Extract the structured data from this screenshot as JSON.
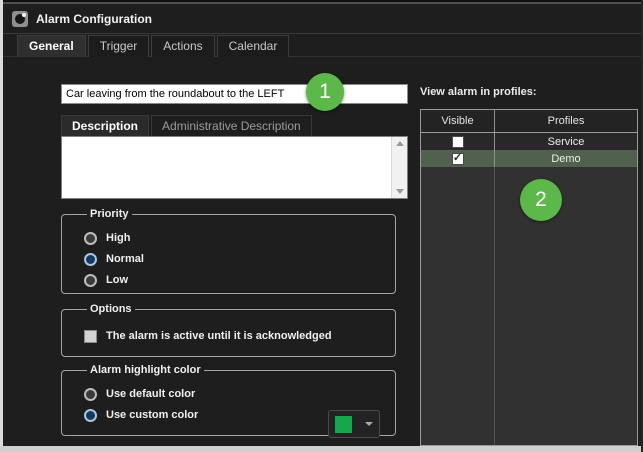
{
  "window": {
    "title": "Alarm Configuration"
  },
  "tabs": [
    {
      "label": "General",
      "selected": true
    },
    {
      "label": "Trigger",
      "selected": false
    },
    {
      "label": "Actions",
      "selected": false
    },
    {
      "label": "Calendar",
      "selected": false
    }
  ],
  "general": {
    "name_value": "Car leaving from the roundabout to the LEFT",
    "description_tabs": [
      {
        "label": "Description",
        "selected": true
      },
      {
        "label": "Administrative Description",
        "selected": false
      }
    ],
    "description_value": "",
    "priority": {
      "legend": "Priority",
      "options": [
        {
          "label": "High",
          "selected": false
        },
        {
          "label": "Normal",
          "selected": true
        },
        {
          "label": "Low",
          "selected": false
        }
      ]
    },
    "options": {
      "legend": "Options",
      "checkbox_label": "The alarm is active until it is acknowledged",
      "checked": false
    },
    "highlight": {
      "legend": "Alarm highlight color",
      "default_label": "Use default color",
      "custom_label": "Use custom color",
      "custom_selected": true
    }
  },
  "profiles_panel": {
    "label": "View alarm in profiles:",
    "columns": [
      "Visible",
      "Profiles"
    ],
    "rows": [
      {
        "name": "Service",
        "visible": false,
        "selected": false
      },
      {
        "name": "Demo",
        "visible": true,
        "selected": true
      }
    ]
  },
  "annotations": [
    {
      "number": "1"
    },
    {
      "number": "2"
    }
  ],
  "icons": {
    "check": "✓"
  },
  "colors": {
    "annotation_green": "#5cb848",
    "custom_swatch_green": "#17a74b",
    "selected_row_green": "#50624e"
  }
}
